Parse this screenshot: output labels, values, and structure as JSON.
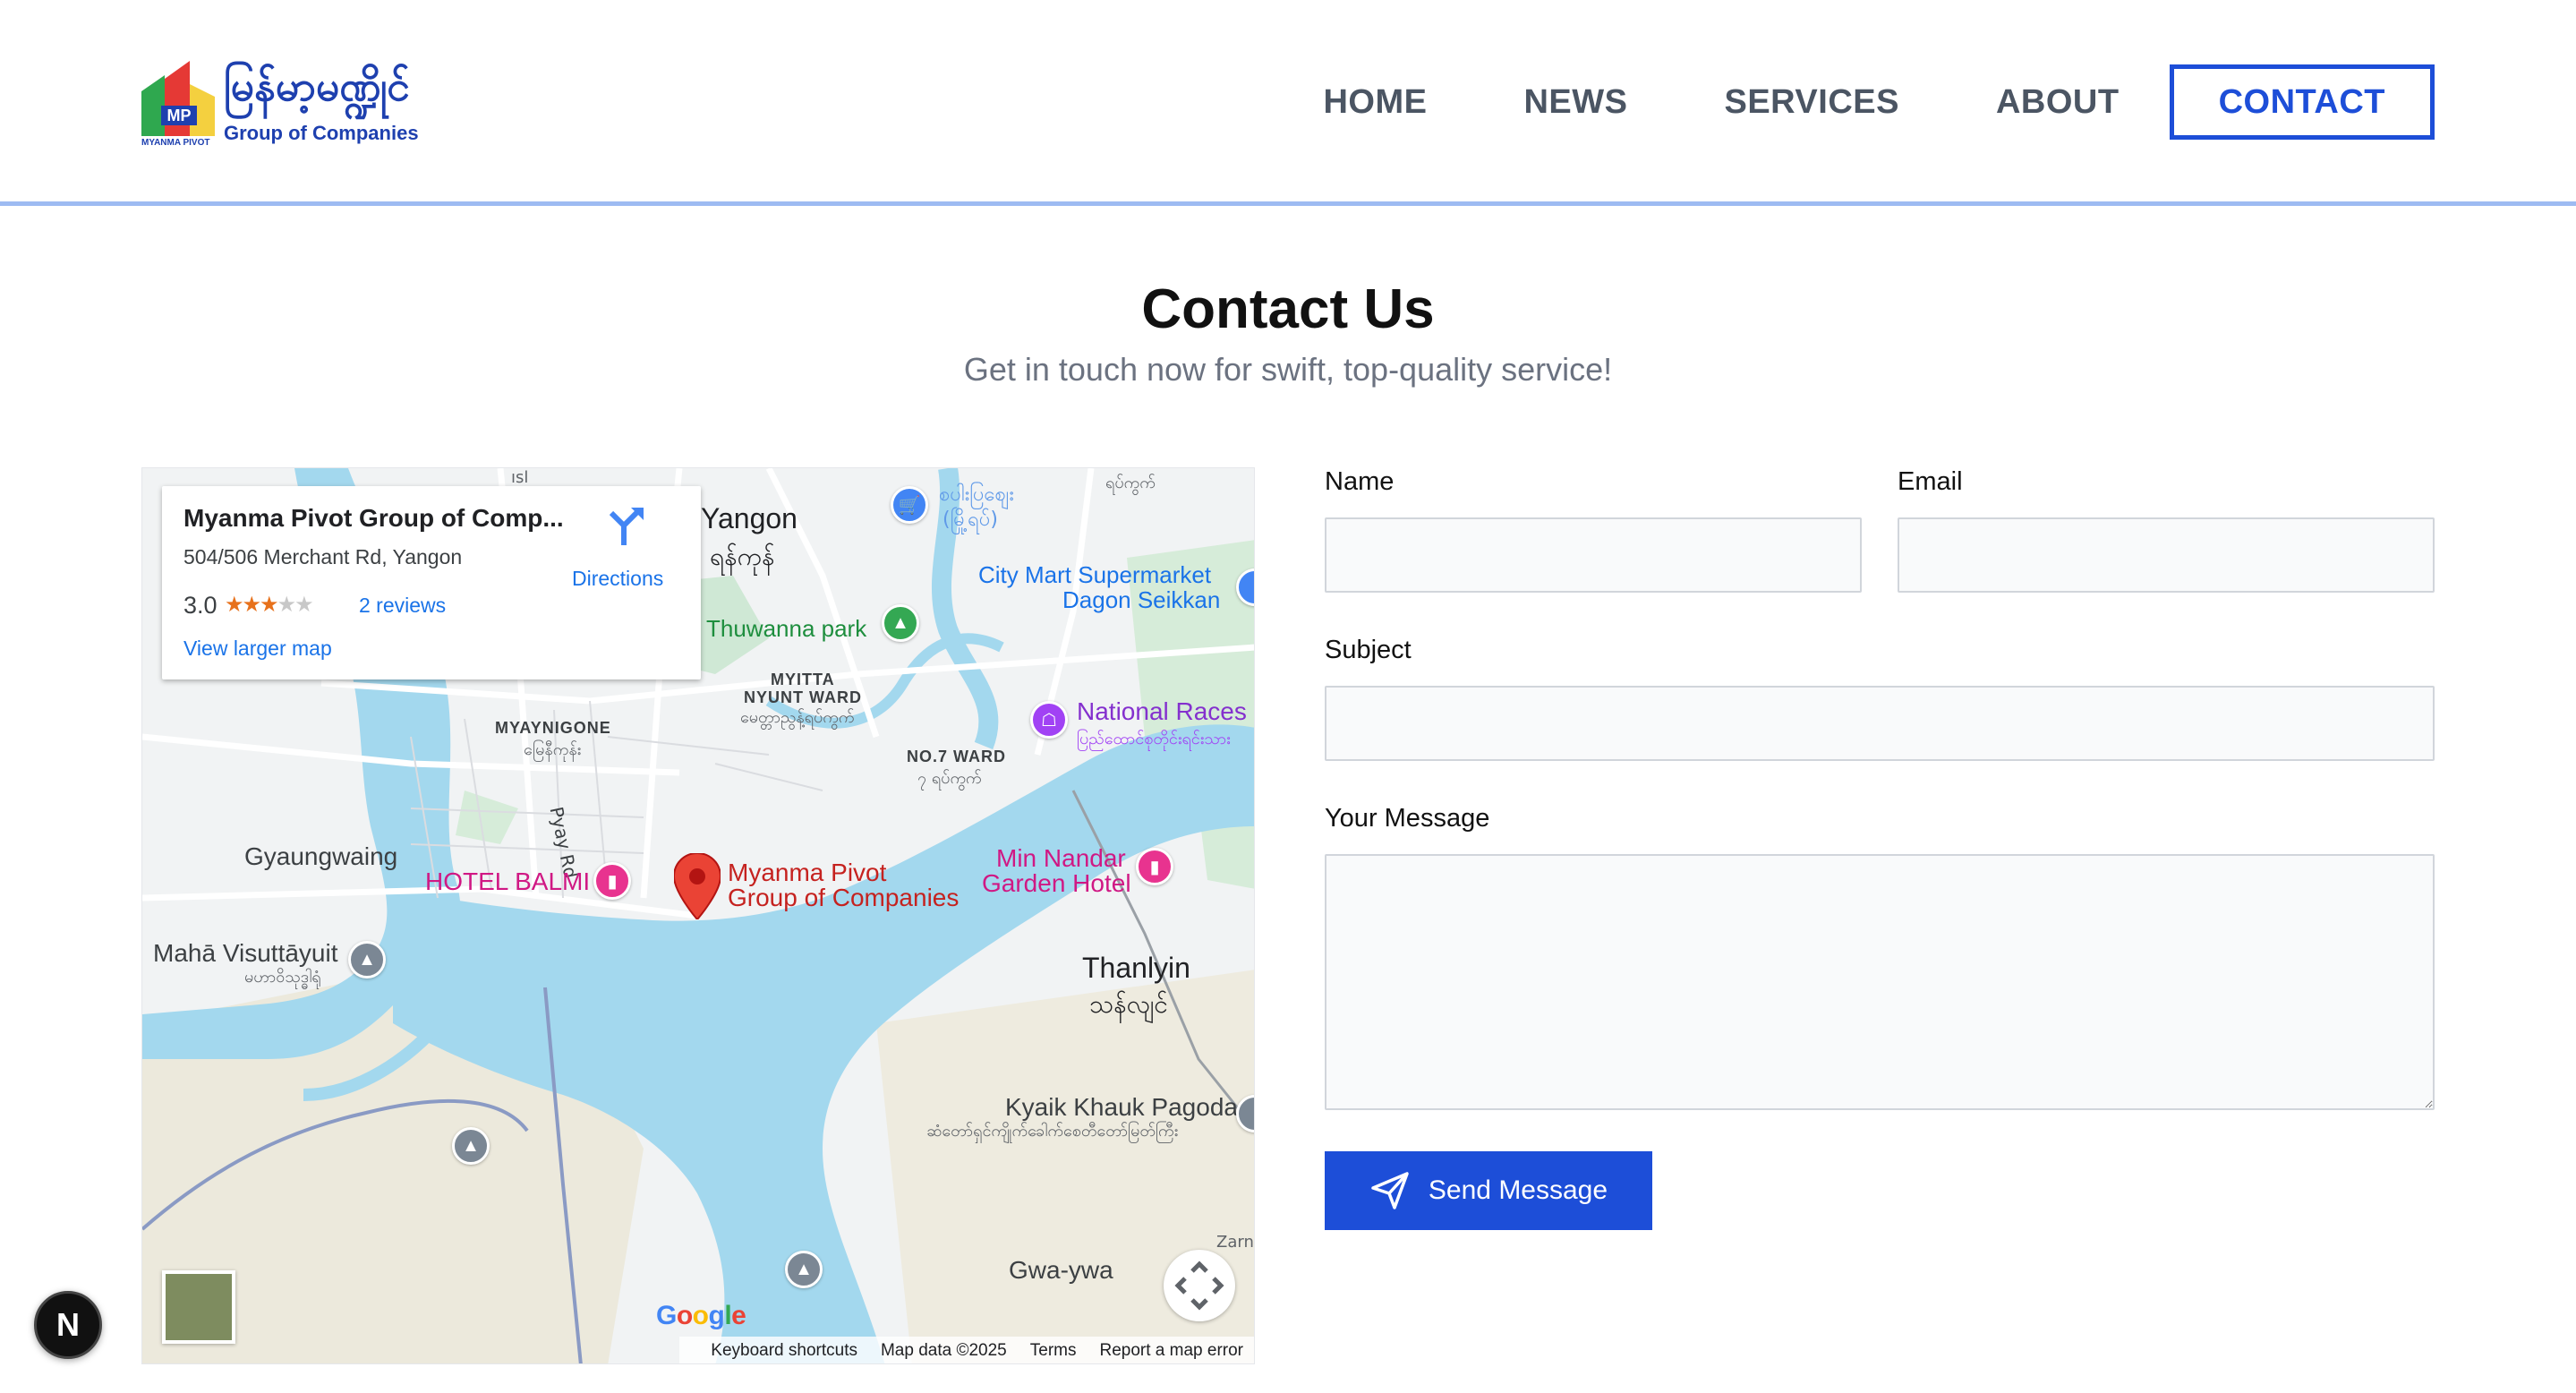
{
  "brand": {
    "name_my": "မြန်မာ့မဏ္ဍိုင်",
    "name_en": "Group of Companies",
    "mark_sub": "MYANMA PIVOT",
    "mark_letters": "MP"
  },
  "nav": {
    "items": [
      {
        "label": "HOME"
      },
      {
        "label": "NEWS"
      },
      {
        "label": "SERVICES"
      },
      {
        "label": "ABOUT"
      },
      {
        "label": "CONTACT",
        "active": true
      }
    ]
  },
  "page": {
    "title": "Contact Us",
    "subtitle": "Get in touch now for swift, top-quality service!"
  },
  "map": {
    "card": {
      "title": "Myanma Pivot Group of Comp...",
      "address": "504/506 Merchant Rd, Yangon",
      "rating": "3.0",
      "rating_stars": 3,
      "reviews": "2 reviews",
      "larger_map": "View larger map",
      "directions": "Directions"
    },
    "labels": {
      "yangon": "Yangon",
      "yangon_my": "ရန်ကုန်",
      "thuwanna": "Thuwanna park",
      "citymart_1": "City Mart Supermarket",
      "citymart_2": "Dagon Seikkan",
      "market_my_1": "စပါးပြစျေး",
      "market_my_2": "(မြို့ရပ်)",
      "top_my": "ရပ်ကွက်",
      "myitta_1": "MYITTA",
      "myitta_2": "NYUNT WARD",
      "myitta_my": "မေတ္တာညွန့်ရပ်ကွက်",
      "myaynigone": "MYAYNIGONE",
      "myaynigone_my": "မြေနီကုန်း",
      "no7_1": "NO.7 WARD",
      "no7_my": "၇ ရပ်ကွက်",
      "national_races": "National Races",
      "national_races_my": "ပြည်ထောင်စုတိုင်းရင်းသား",
      "pyay_rd": "Pyay Rd",
      "gyaungwaing": "Gyaungwaing",
      "hotel_balmi": "HOTEL BALMI",
      "pin_1": "Myanma Pivot",
      "pin_2": "Group of Companies",
      "min_nandar_1": "Min Nandar",
      "min_nandar_2": "Garden Hotel",
      "maha_1": "Mahā Visuttāyuit",
      "maha_my": "မဟာဝိသုဒ္ဓါရုံ",
      "thanlyin": "Thanlyin",
      "thanlyin_my": "သန်လျင်",
      "kyaik_1": "Kyaik Khauk Pagoda",
      "kyaik_my": "ဆံတော်ရှင်ကျိုက်ခေါက်စေတီတော်မြတ်ကြီး",
      "zarn": "Zarn",
      "gwa_ywa": "Gwa-ywa",
      "isl": "ısl"
    },
    "google": [
      "G",
      "o",
      "o",
      "g",
      "l",
      "e"
    ],
    "footer": {
      "shortcuts": "Keyboard shortcuts",
      "data": "Map data ©2025",
      "terms": "Terms",
      "report": "Report a map error"
    }
  },
  "form": {
    "name_label": "Name",
    "name_value": "",
    "email_label": "Email",
    "email_value": "",
    "subject_label": "Subject",
    "subject_value": "",
    "message_label": "Your Message",
    "message_value": "",
    "send_label": "Send Message"
  },
  "dev_badge": "N",
  "colors": {
    "accent": "#1d4ed8",
    "nav_text": "#4b5563",
    "header_border": "#9dbbf2",
    "water": "#a3d8ee",
    "land": "#f1f3f4",
    "park": "#cfe8d5"
  }
}
